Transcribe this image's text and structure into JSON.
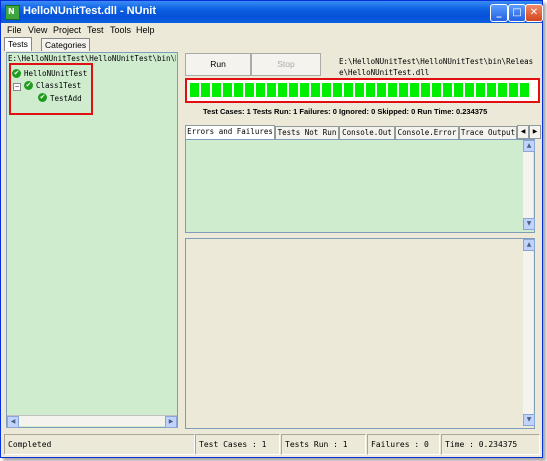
{
  "window": {
    "title": "HelloNUnitTest.dll - NUnit",
    "app_icon_letter": "N"
  },
  "title_buttons": {
    "minimize": "_",
    "maximize": "□",
    "close": "✕"
  },
  "menu": [
    "File",
    "View",
    "Project",
    "Test",
    "Tools",
    "Help"
  ],
  "left_tabs": [
    "Tests",
    "Categories"
  ],
  "tree": {
    "path": "E:\\HelloNUnitTest\\HelloNUnitTest\\bin\\Release\\HelloNUnitTest.dll",
    "nodes": [
      {
        "label": "HelloNUnitTest",
        "status": "passed"
      },
      {
        "label": "Class1Test",
        "status": "passed",
        "expander": "−"
      },
      {
        "label": "TestAdd",
        "status": "passed"
      }
    ],
    "tick_glyph": "✔"
  },
  "buttons": {
    "run": "Run",
    "stop": "Stop"
  },
  "assembly_path": {
    "line1": "E:\\HelloNUnitTest\\HelloNUnitTest\\bin\\Releas",
    "line2": "e\\HelloNUnitTest.dll"
  },
  "progress": {
    "fraction": 1.0,
    "color": "#00ee00"
  },
  "summary": {
    "text": "Test Cases: 1   Tests Run: 1   Failures: 0   Ignored: 0   Skipped: 0   Run Time: 0.234375"
  },
  "result_tabs": [
    "Errors and Failures",
    "Tests Not Run",
    "Console.Out",
    "Console.Error",
    "Trace Output"
  ],
  "scroll_arrows": {
    "left": "◀",
    "right": "▶",
    "up": "▲",
    "down": "▼"
  },
  "status_bar": {
    "status": "Completed",
    "test_cases": "Test Cases : 1",
    "tests_run": "Tests Run : 1",
    "failures": "Failures : 0",
    "time": "Time : 0.234375"
  },
  "colors": {
    "pass_green": "#1f9c1f",
    "highlight_red": "#e01010",
    "pane_green": "#d0eccf"
  }
}
